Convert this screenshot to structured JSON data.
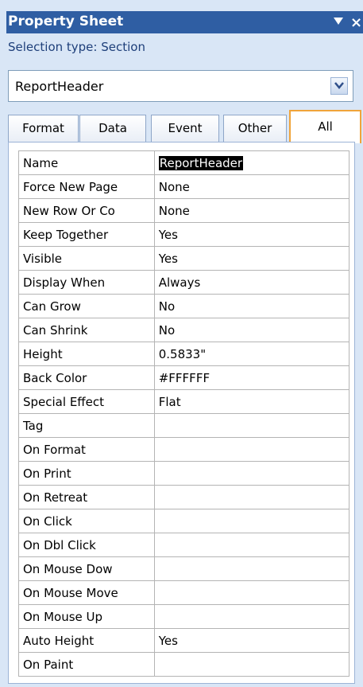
{
  "title": "Property Sheet",
  "selection_type": "Selection type: Section",
  "object_selector": {
    "value": "ReportHeader"
  },
  "tabs": [
    {
      "label": "Format"
    },
    {
      "label": "Data"
    },
    {
      "label": "Event"
    },
    {
      "label": "Other"
    },
    {
      "label": "All",
      "active": true
    }
  ],
  "properties": [
    {
      "name": "Name",
      "value": "ReportHeader"
    },
    {
      "name": "Force New Page",
      "value": "None"
    },
    {
      "name": "New Row Or Co",
      "value": "None"
    },
    {
      "name": "Keep Together",
      "value": "Yes"
    },
    {
      "name": "Visible",
      "value": "Yes"
    },
    {
      "name": "Display When",
      "value": "Always"
    },
    {
      "name": "Can Grow",
      "value": "No"
    },
    {
      "name": "Can Shrink",
      "value": "No"
    },
    {
      "name": "Height",
      "value": "0.5833\""
    },
    {
      "name": "Back Color",
      "value": "#FFFFFF"
    },
    {
      "name": "Special Effect",
      "value": "Flat"
    },
    {
      "name": "Tag",
      "value": ""
    },
    {
      "name": "On Format",
      "value": ""
    },
    {
      "name": "On Print",
      "value": ""
    },
    {
      "name": "On Retreat",
      "value": ""
    },
    {
      "name": "On Click",
      "value": ""
    },
    {
      "name": "On Dbl Click",
      "value": ""
    },
    {
      "name": "On Mouse Dow",
      "value": ""
    },
    {
      "name": "On Mouse Move",
      "value": ""
    },
    {
      "name": "On Mouse Up",
      "value": ""
    },
    {
      "name": "Auto Height",
      "value": "Yes"
    },
    {
      "name": "On Paint",
      "value": ""
    }
  ],
  "colors": {
    "title_bar": "#2f5ea3",
    "panel": "#d9e6f6",
    "active_tab_border": "#f0a43a"
  }
}
